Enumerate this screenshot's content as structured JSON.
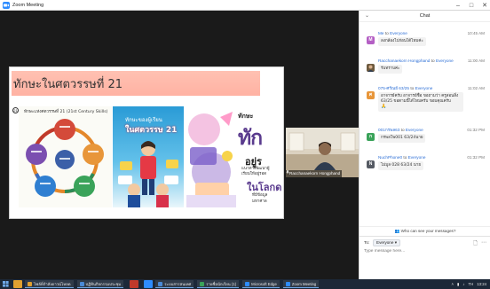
{
  "window": {
    "title": "Zoom Meeting",
    "controls": {
      "minimize": "–",
      "maximize": "□",
      "close": "✕"
    }
  },
  "slide": {
    "title": "ทักษะในศตวรรษที่ 21",
    "page_number": "21",
    "image1": {
      "title": "ทักษะแห่งศตวรรษที่ 21 (21st Century Skills)"
    },
    "image2": {
      "line1": "ทักษะของผู้เรียน",
      "line2": "ในศตวรรษ 21"
    },
    "image3": {
      "line1": "ทักษะ",
      "line2": "ทัก",
      "line3": "อยู่ร",
      "line4": "แนวทางพัฒนาผู้เรียนให้อยู่รอด",
      "line5": "ในโลกด",
      "line6": "ที่มีข้อมูลมหาศาล"
    }
  },
  "video": {
    "participant_name": "Racchanaekorn Hongphand"
  },
  "chat": {
    "title": "Chat",
    "messages": [
      {
        "sender": "Me",
        "to_word": "to",
        "recipient": "Everyone",
        "time": "10:45 AM",
        "avatar": "M",
        "avatar_color": "#b45fc4",
        "text": "ลงกล้องไปก่อนได้ไหมค่ะ"
      },
      {
        "sender": "Racchanaekorn Hongphand",
        "to_word": "to",
        "recipient": "Everyone",
        "time": "11:00 AM",
        "avatar": "",
        "avatar_color": "#6d5a3e",
        "text": "รับทราบค่ะ"
      },
      {
        "sender": "075-ศรัณย์ 63/25",
        "to_word": "to",
        "recipient": "Everyone",
        "time": "11:02 AM",
        "avatar": "ศ",
        "avatar_color": "#e8963a",
        "text": "อาจารย์ครับ อาจารย์ชื่อ ขอถามว่า ครูสอนสิ่ง 63/25 ขอตามนี้ได้ไหมครับ ขอบคุณครับ",
        "icon": "🙏"
      },
      {
        "sender": "001กรพล63",
        "to_word": "to",
        "recipient": "Everyone",
        "time": "01:32 PM",
        "avatar": "ก",
        "avatar_color": "#3aa35a",
        "text": "กรพลโพ001 63/24นาย"
      },
      {
        "sender": "NuchPhone0",
        "to_word": "to",
        "recipient": "Everyone",
        "time": "01:32 PM",
        "avatar": "N",
        "avatar_color": "#555a63",
        "text": "ไม่มูล 028 63/24 นาย"
      }
    ],
    "who_can_see": "Who can see your messages?",
    "to_label": "To:",
    "to_value": "Everyone",
    "input_placeholder": "Type message here..."
  },
  "taskbar": {
    "items": [
      {
        "label": "ไฟล์ที่กำลังดาวน์โหลด",
        "color": "#e0a030"
      },
      {
        "label": "ปฏิทินกิจกรรมประชุม",
        "color": "#4a8ad6"
      },
      {
        "label": "",
        "color": "#c0392b"
      },
      {
        "label": "",
        "color": "#2d8cff"
      },
      {
        "label": "ระบบสารสนเทศ",
        "color": "#4a8ad6"
      },
      {
        "label": "รายชื่อนักเรียน (1)",
        "color": "#3aa35a"
      },
      {
        "label": "Microsoft Edge",
        "color": "#2d8cff"
      },
      {
        "label": "Zoom Meeting",
        "color": "#2d8cff"
      }
    ],
    "tray": {
      "lang": "TH",
      "time": "13:24"
    }
  }
}
